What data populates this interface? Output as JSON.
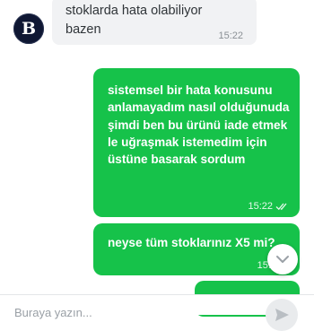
{
  "chat": {
    "avatar": {
      "letter": "B"
    },
    "incoming": {
      "text": "stoklarda hata olabiliyor bazen",
      "time": "15:22"
    },
    "outgoing": [
      {
        "text": "sistemsel bir hata konusunu anlamayadım nasıl olduğunuda şimdi ben bu ürünü iade etmek le uğraşmak istemedim için üstüne basarak sordum",
        "time": "15:22",
        "status_icon": "double-check-icon"
      },
      {
        "text": "neyse tüm stoklarınız X5 mi?",
        "time": "15:2"
      }
    ]
  },
  "composer": {
    "placeholder": "Buraya yazın..."
  },
  "colors": {
    "outgoing_bubble": "#16c24a",
    "incoming_bubble": "#f1f2f4"
  },
  "icons": {
    "scroll_down": "chevron-down-icon",
    "send": "send-icon"
  }
}
